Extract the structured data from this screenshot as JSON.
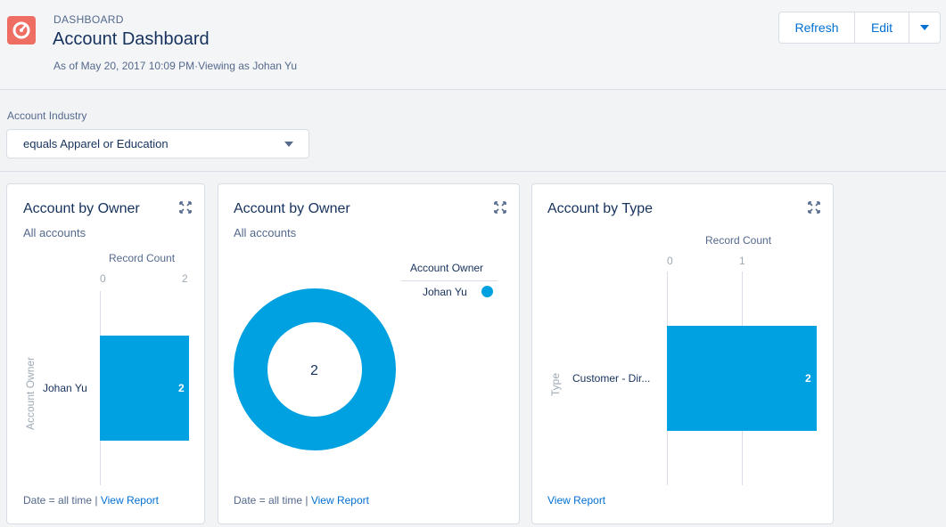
{
  "header": {
    "eyebrow": "DASHBOARD",
    "title": "Account Dashboard",
    "subtitle": "As of May 20, 2017 10:09 PM·Viewing as Johan Yu",
    "buttons": {
      "refresh": "Refresh",
      "edit": "Edit"
    },
    "icon": "dashboard-gauge-icon",
    "icon_color": "#ef6e64"
  },
  "filter": {
    "label": "Account Industry",
    "value": "equals Apparel or Education"
  },
  "cards": [
    {
      "title": "Account by Owner",
      "subtitle": "All accounts",
      "footer_prefix": "Date = all time | ",
      "footer_link": "View Report",
      "chart_data": {
        "type": "bar",
        "orientation": "horizontal",
        "title": "",
        "xlabel": "Record Count",
        "ylabel": "Account Owner",
        "categories": [
          "Johan Yu"
        ],
        "values": [
          2
        ],
        "xlim": [
          0,
          2
        ],
        "x_ticks": [
          "0",
          "2"
        ],
        "data_labels": [
          "2"
        ],
        "color": "#00a1e0"
      }
    },
    {
      "title": "Account by Owner",
      "subtitle": "All accounts",
      "footer_prefix": "Date = all time | ",
      "footer_link": "View Report",
      "chart_data": {
        "type": "pie",
        "style": "donut",
        "center_label": "2",
        "legend_title": "Account Owner",
        "legend_placement": "top-right",
        "categories": [
          "Johan Yu"
        ],
        "values": [
          2
        ],
        "color": "#00a1e0"
      }
    },
    {
      "title": "Account by Type",
      "subtitle": "",
      "footer_prefix": "",
      "footer_link": "View Report",
      "chart_data": {
        "type": "bar",
        "orientation": "horizontal",
        "title": "",
        "xlabel": "Record Count",
        "ylabel": "Type",
        "categories": [
          "Customer - Dir..."
        ],
        "values": [
          2
        ],
        "xlim": [
          0,
          2
        ],
        "x_ticks": [
          "0",
          "1"
        ],
        "data_labels": [
          "2"
        ],
        "color": "#00a1e0"
      }
    }
  ]
}
